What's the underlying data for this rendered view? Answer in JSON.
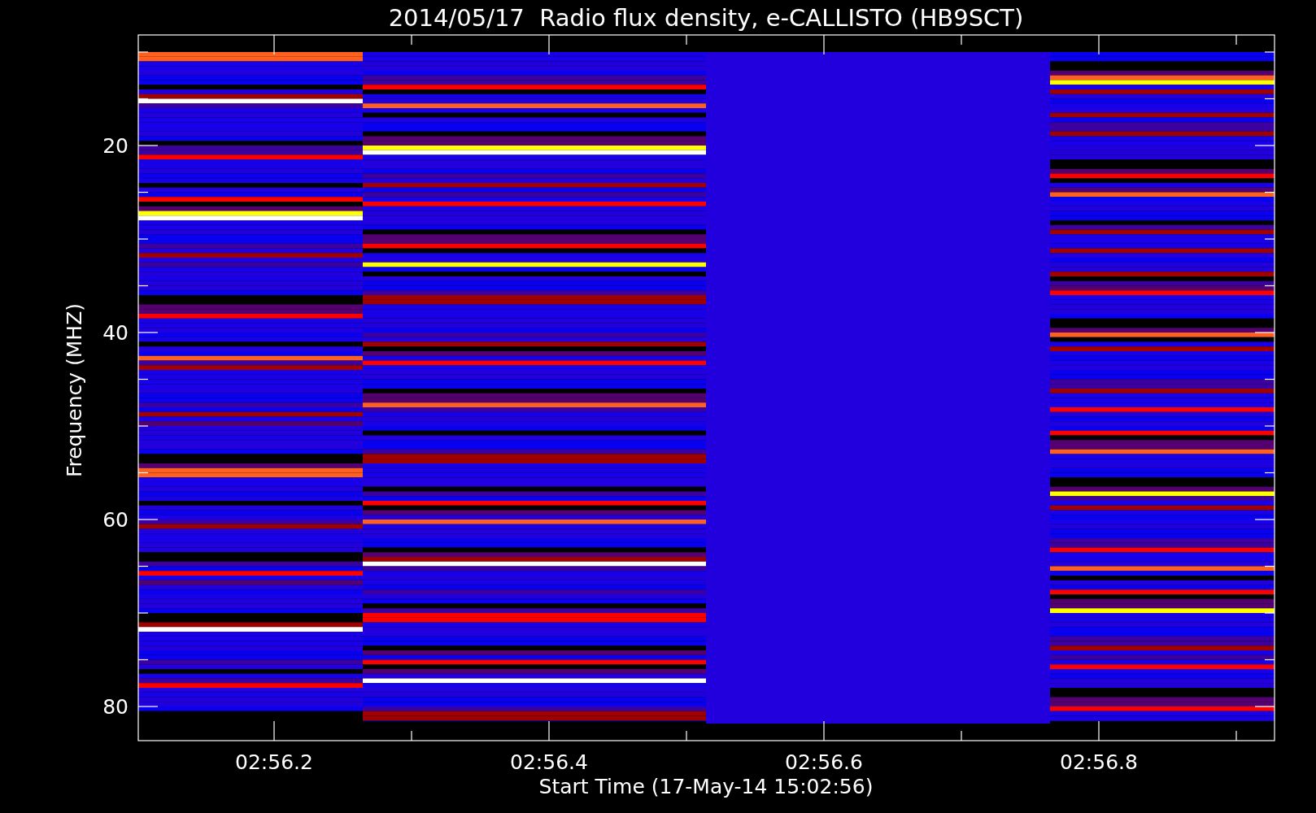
{
  "title": "2014/05/17  Radio flux density, e-CALLISTO (HB9SCT)",
  "y_axis": {
    "label": "Frequency (MHZ)",
    "ticks": [
      "20",
      "40",
      "60",
      "80"
    ]
  },
  "x_axis": {
    "label": "Start Time (17-May-14 15:02:56)",
    "ticks": [
      "02:56.2",
      "02:56.4",
      "02:56.6",
      "02:56.8"
    ]
  }
}
